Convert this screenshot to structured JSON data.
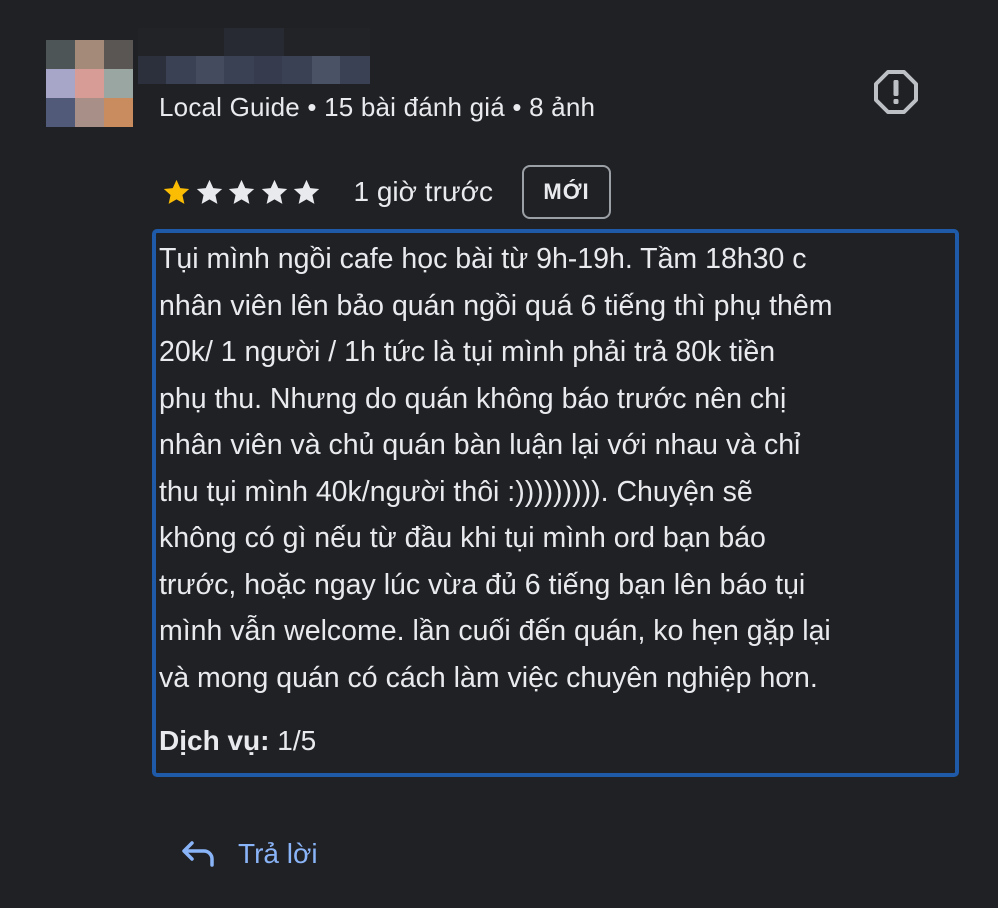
{
  "reviewer": {
    "meta": "Local Guide • 15 bài đánh giá • 8 ảnh"
  },
  "rating": {
    "filled": 1,
    "total": 5,
    "time": "1 giờ trước",
    "badge": "MỚI"
  },
  "review": {
    "lines": [
      "Tụi mình ngồi cafe học bài từ 9h-19h. Tầm 18h30 c",
      "nhân viên lên bảo quán ngồi quá 6 tiếng thì phụ thêm",
      "20k/ 1 người / 1h tức là tụi mình phải trả 80k tiền",
      "phụ thu. Nhưng do quán không báo trước nên chị",
      "nhân viên và chủ quán bàn luận lại với nhau và chỉ",
      "thu tụi mình 40k/người thôi :))))))))). Chuyện sẽ",
      "không có gì nếu từ đầu khi tụi mình ord bạn báo",
      "trước, hoặc ngay lúc vừa đủ 6 tiếng bạn lên báo tụi",
      "mình vẫn welcome. lần cuối đến quán, ko hẹn gặp lại",
      "và mong quán có cách làm việc chuyên nghiệp hơn."
    ],
    "service_label": "Dịch vụ:",
    "service_value": "1/5"
  },
  "actions": {
    "reply_label": "Trả lời"
  },
  "icons": {
    "report": "report-icon",
    "star": "star-icon",
    "reply": "reply-arrow-icon"
  },
  "colors": {
    "background": "#202124",
    "star_filled": "#fbbc04",
    "star_empty": "#e8eaed",
    "highlight_border": "#1f5aa8",
    "link": "#8ab4f8"
  }
}
